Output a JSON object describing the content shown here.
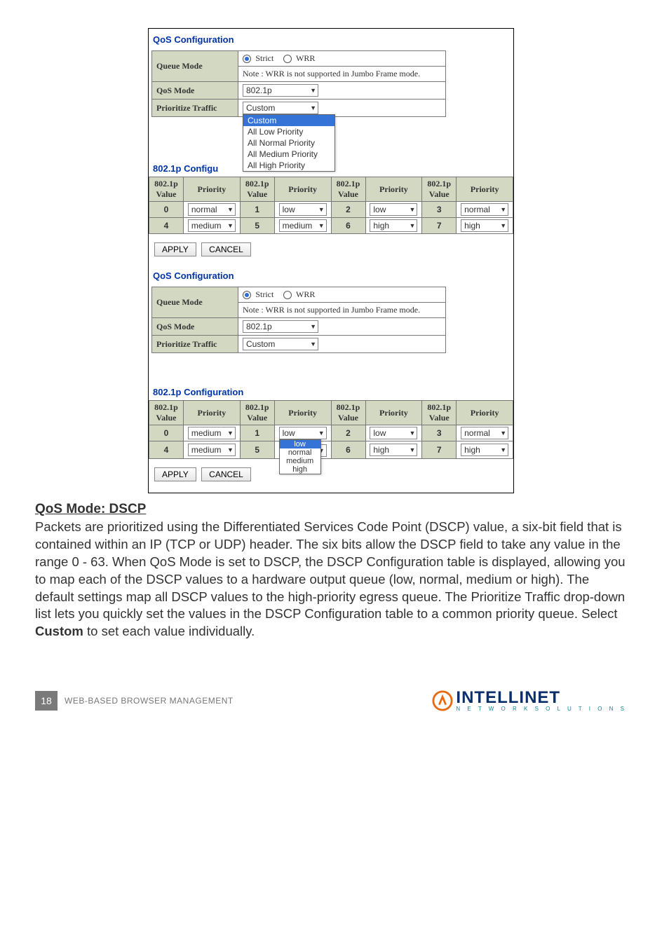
{
  "figure1": {
    "title": "QoS Configuration",
    "queue_mode_label": "Queue Mode",
    "strict_label": "Strict",
    "wrr_label": "WRR",
    "note": "Note : WRR is not supported in Jumbo Frame mode.",
    "qos_mode_label": "QoS Mode",
    "qos_mode_value": "802.1p",
    "prioritize_label": "Prioritize Traffic",
    "prioritize_value": "Custom",
    "dd_opts": [
      "Custom",
      "All Low Priority",
      "All Normal Priority",
      "All Medium Priority",
      "All High Priority"
    ],
    "sect": "802.1p Configu",
    "hdr_val": "802.1p Value",
    "hdr_pri": "Priority",
    "rows": [
      {
        "v": "0",
        "p": "normal"
      },
      {
        "v": "1",
        "p": "low"
      },
      {
        "v": "2",
        "p": "low"
      },
      {
        "v": "3",
        "p": "normal"
      },
      {
        "v": "4",
        "p": "medium"
      },
      {
        "v": "5",
        "p": "medium"
      },
      {
        "v": "6",
        "p": "high"
      },
      {
        "v": "7",
        "p": "high"
      }
    ],
    "apply": "APPLY",
    "cancel": "CANCEL"
  },
  "figure2": {
    "title": "QoS Configuration",
    "queue_mode_label": "Queue Mode",
    "strict_label": "Strict",
    "wrr_label": "WRR",
    "note": "Note : WRR is not supported in Jumbo Frame mode.",
    "qos_mode_label": "QoS Mode",
    "qos_mode_value": "802.1p",
    "prioritize_label": "Prioritize Traffic",
    "prioritize_value": "Custom",
    "sect": "802.1p Configuration",
    "hdr_val": "802.1p Value",
    "hdr_pri": "Priority",
    "rows": [
      {
        "v": "0",
        "p": "medium"
      },
      {
        "v": "1",
        "p": "low"
      },
      {
        "v": "2",
        "p": "low"
      },
      {
        "v": "3",
        "p": "normal"
      },
      {
        "v": "4",
        "p": "medium"
      },
      {
        "v": "5",
        "p": ""
      },
      {
        "v": "6",
        "p": "high"
      },
      {
        "v": "7",
        "p": "high"
      }
    ],
    "dd2_opts": [
      "low",
      "normal",
      "medium",
      "high"
    ],
    "apply": "APPLY",
    "cancel": "CANCEL"
  },
  "body": {
    "heading": "QoS Mode: DSCP",
    "p1": "Packets are prioritized using the Differentiated Services Code Point (DSCP) value, a six-bit field that is contained within an IP (TCP or UDP) header. The six bits allow the DSCP field to take any value in the range 0 - 63. When QoS Mode is set to DSCP, the DSCP Configuration table is displayed, allowing you to map each of the DSCP values to a hardware output queue (low, normal, medium or high). The default settings map all DSCP values to the high-priority egress queue. The Prioritize Traffic drop-down list lets you quickly set the values in the DSCP Configuration table to a common priority queue. Select ",
    "bold": "Custom",
    "p2": " to set each value individually."
  },
  "footer": {
    "page": "18",
    "label": "WEB-BASED BROWSER MANAGEMENT",
    "brand": "INTELLINET",
    "tag": "N E T W O R K   S O L U T I O N S"
  }
}
